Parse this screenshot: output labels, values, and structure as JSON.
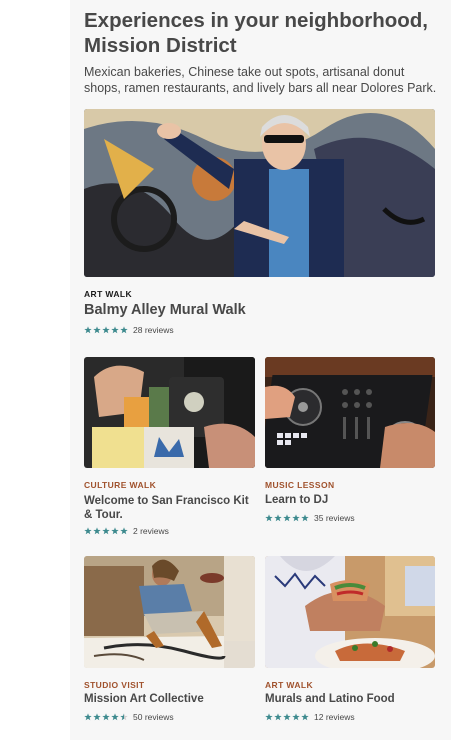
{
  "section": {
    "title": "Experiences in your neighborhood, Mission District",
    "subtitle": "Mexican bakeries, Chinese take out spots, artisanal donut shops, ramen restaurants, and lively bars all near Dolores Park."
  },
  "colors": {
    "star": "#3d8a8e",
    "category_dark": "#1a1a1a",
    "category_brown": "#a0522d"
  },
  "cards": [
    {
      "category": "ART WALK",
      "title": "Balmy Alley Mural Walk",
      "stars": 5,
      "reviews": "28 reviews"
    },
    {
      "category": "CULTURE WALK",
      "title": "Welcome to San Francisco Kit & Tour.",
      "stars": 5,
      "reviews": "2 reviews"
    },
    {
      "category": "MUSIC LESSON",
      "title": "Learn to DJ",
      "stars": 5,
      "reviews": "35 reviews"
    },
    {
      "category": "STUDIO VISIT",
      "title": "Mission Art Collective",
      "stars": 4.5,
      "reviews": "50 reviews"
    },
    {
      "category": "ART WALK",
      "title": "Murals and Latino Food",
      "stars": 5,
      "reviews": "12 reviews"
    }
  ]
}
